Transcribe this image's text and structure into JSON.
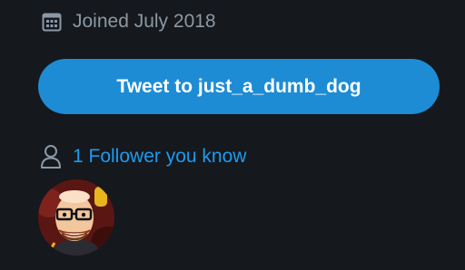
{
  "profile": {
    "joined_text": "Joined July 2018",
    "tweet_button_label": "Tweet to just_a_dumb_dog",
    "followers_you_know_text": "1 Follower you know"
  },
  "icons": {
    "joined": "calendar-icon",
    "followers": "person-icon"
  },
  "colors": {
    "background": "#15181c",
    "secondary_text": "#8b98a5",
    "button": "#1d8cd5",
    "link": "#1d9bf0"
  }
}
